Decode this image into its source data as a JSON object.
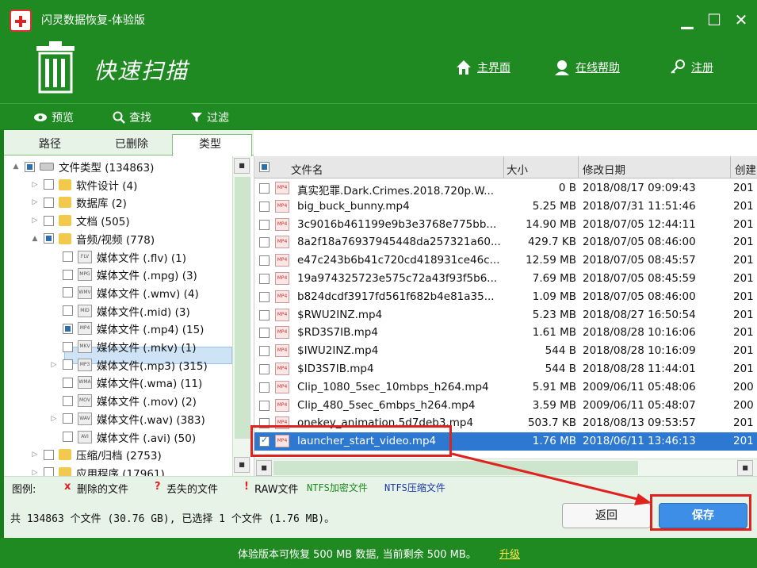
{
  "window": {
    "title": "闪灵数据恢复-体验版",
    "minimize": "▁",
    "maximize": "☐",
    "close": "✕"
  },
  "header": {
    "mode_title": "快速扫描",
    "nav": {
      "home": "主界面",
      "help": "在线帮助",
      "register": "注册"
    }
  },
  "toolbar": {
    "preview": "预览",
    "find": "查找",
    "filter": "过滤"
  },
  "tabs": {
    "path": "路径",
    "deleted": "已删除",
    "type": "类型"
  },
  "tree": {
    "items": [
      {
        "label": "文件类型 (134863)",
        "icon": "drive-icon"
      },
      {
        "label": "软件设计 (4)",
        "icon": "folder-icon"
      },
      {
        "label": "数据库 (2)",
        "icon": "folder-icon"
      },
      {
        "label": "文档 (505)",
        "icon": "folder-icon"
      },
      {
        "label": "音频/视频 (778)",
        "icon": "folder-icon"
      },
      {
        "label": "媒体文件 (.flv) (1)",
        "icon": "FLV"
      },
      {
        "label": "媒体文件 (.mpg) (3)",
        "icon": "MPG"
      },
      {
        "label": "媒体文件 (.wmv) (4)",
        "icon": "WMV"
      },
      {
        "label": "媒体文件(.mid) (3)",
        "icon": "MID"
      },
      {
        "label": "媒体文件 (.mp4) (15)",
        "icon": "MP4"
      },
      {
        "label": "媒体文件 (.mkv) (1)",
        "icon": "MKV"
      },
      {
        "label": "媒体文件(.mp3) (315)",
        "icon": "MP3"
      },
      {
        "label": "媒体文件(.wma) (11)",
        "icon": "WMA"
      },
      {
        "label": "媒体文件 (.mov) (2)",
        "icon": "MOV"
      },
      {
        "label": "媒体文件(.wav) (383)",
        "icon": "WAV"
      },
      {
        "label": "媒体文件 (.avi) (50)",
        "icon": "AVI"
      },
      {
        "label": "压缩/归档 (2753)",
        "icon": "folder-icon"
      },
      {
        "label": "应用程序 (17961)",
        "icon": "folder-icon"
      }
    ]
  },
  "list": {
    "columns": {
      "name": "文件名",
      "size": "大小",
      "modified": "修改日期",
      "created": "创建"
    },
    "rows": [
      {
        "name": "真实犯罪.Dark.Crimes.2018.720p.W...",
        "size": "0 B",
        "modified": "2018/08/17 09:09:43",
        "created": "201"
      },
      {
        "name": "big_buck_bunny.mp4",
        "size": "5.25 MB",
        "modified": "2018/07/31 11:51:46",
        "created": "201"
      },
      {
        "name": "3c9016b461199e9b3e3768e775bb...",
        "size": "14.90 MB",
        "modified": "2018/07/05 12:44:11",
        "created": "201"
      },
      {
        "name": "8a2f18a76937945448da257321a60...",
        "size": "429.7 KB",
        "modified": "2018/07/05 08:46:00",
        "created": "201"
      },
      {
        "name": "e47c243b6b41c720cd418931ce46c...",
        "size": "12.59 MB",
        "modified": "2018/07/05 08:45:57",
        "created": "201"
      },
      {
        "name": "19a974325723e575c72a43f93f5b6...",
        "size": "7.69 MB",
        "modified": "2018/07/05 08:45:59",
        "created": "201"
      },
      {
        "name": "b824dcdf3917fd561f682b4e81a35...",
        "size": "1.09 MB",
        "modified": "2018/07/05 08:46:00",
        "created": "201"
      },
      {
        "name": "$RWU2INZ.mp4",
        "size": "5.23 MB",
        "modified": "2018/08/27 16:50:54",
        "created": "201"
      },
      {
        "name": "$RD3S7IB.mp4",
        "size": "1.61 MB",
        "modified": "2018/08/28 10:16:06",
        "created": "201"
      },
      {
        "name": "$IWU2INZ.mp4",
        "size": "544 B",
        "modified": "2018/08/28 10:16:09",
        "created": "201"
      },
      {
        "name": "$ID3S7IB.mp4",
        "size": "544 B",
        "modified": "2018/08/28 11:44:01",
        "created": "201"
      },
      {
        "name": "Clip_1080_5sec_10mbps_h264.mp4",
        "size": "5.91 MB",
        "modified": "2009/06/11 05:48:06",
        "created": "200"
      },
      {
        "name": "Clip_480_5sec_6mbps_h264.mp4",
        "size": "3.59 MB",
        "modified": "2009/06/11 05:48:07",
        "created": "200"
      },
      {
        "name": "onekey_animation.5d7deb3.mp4",
        "size": "503.7 KB",
        "modified": "2018/08/13 09:53:57",
        "created": "201"
      },
      {
        "name": "launcher_start_video.mp4",
        "size": "1.76 MB",
        "modified": "2018/06/11 13:46:13",
        "created": "201"
      }
    ]
  },
  "legend": {
    "label": "图例:",
    "deleted": "删除的文件",
    "lost": "丢失的文件",
    "raw": "RAW文件",
    "ntfs_enc": "NTFS加密文件",
    "ntfs_comp": "NTFS压缩文件",
    "deleted_mark": "x",
    "lost_mark": "?",
    "raw_mark": "!"
  },
  "status": {
    "summary": "共 134863 个文件 (30.76 GB), 已选择 1 个文件 (1.76 MB)。",
    "back": "返回",
    "save": "保存"
  },
  "footer": {
    "text": "体验版本可恢复 500 MB 数据, 当前剩余 500 MB。",
    "upgrade": "升级"
  },
  "colors": {
    "brand_green": "#1f8a22",
    "selection_blue": "#2d79d1",
    "highlight_red": "#e0221e"
  }
}
